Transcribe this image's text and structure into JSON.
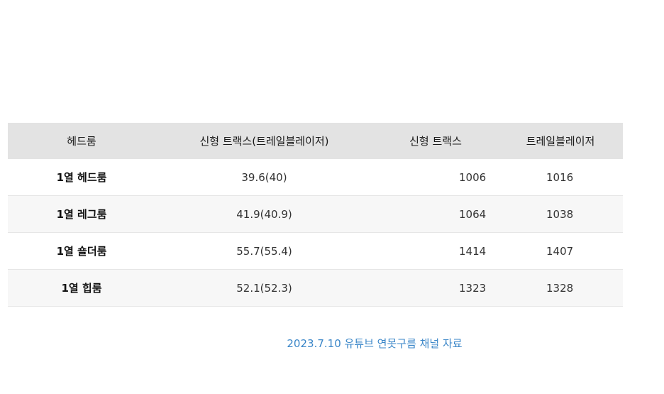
{
  "table": {
    "headers": [
      "헤드룸",
      "신형 트랙스(트레일블레이저)",
      "신형 트랙스",
      "트레일블레이저"
    ],
    "rows": [
      {
        "label": "1열 헤드룸",
        "combined": "39.6(40)",
        "trax": "1006",
        "trailblazer": "1016"
      },
      {
        "label": "1열 레그룸",
        "combined": "41.9(40.9)",
        "trax": "1064",
        "trailblazer": "1038"
      },
      {
        "label": "1열 숄더룸",
        "combined": "55.7(55.4)",
        "trax": "1414",
        "trailblazer": "1407"
      },
      {
        "label": "1열 힙룸",
        "combined": "52.1(52.3)",
        "trax": "1323",
        "trailblazer": "1328"
      }
    ]
  },
  "caption": "2023.7.10 유튜브 연못구름 채널 자료",
  "colors": {
    "header_bg": "#e3e3e3",
    "highlight": "#e8323c",
    "caption": "#3a86c8"
  }
}
